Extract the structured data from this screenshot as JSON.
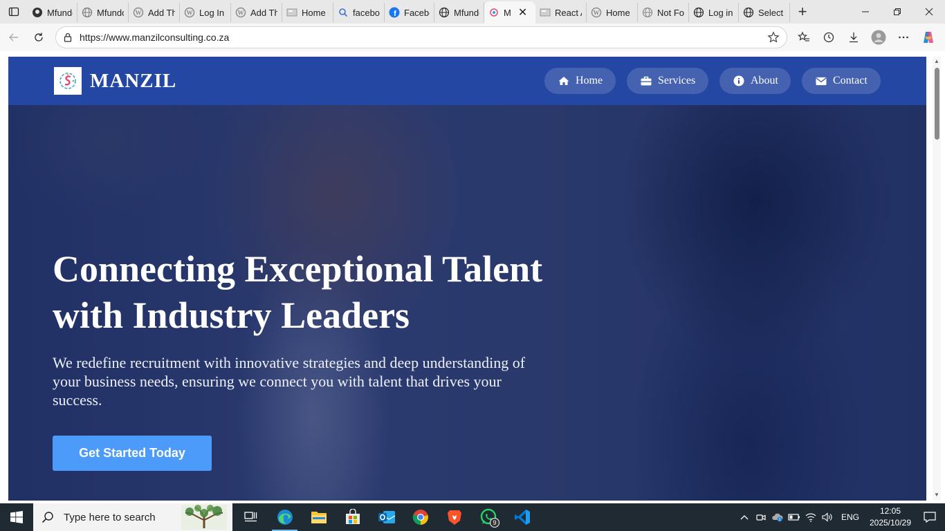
{
  "browser": {
    "tabs": [
      {
        "label": "Mfundo",
        "icon": "github-icon"
      },
      {
        "label": "Mfundo",
        "icon": "globe-icon"
      },
      {
        "label": "Add Th",
        "icon": "wordpress-icon"
      },
      {
        "label": "Log In",
        "icon": "wordpress-icon"
      },
      {
        "label": "Add Th",
        "icon": "wordpress-icon"
      },
      {
        "label": "Home -",
        "icon": "page-icon"
      },
      {
        "label": "facebo",
        "icon": "search-icon"
      },
      {
        "label": "Facebo",
        "icon": "facebook-icon"
      },
      {
        "label": "Mfundo",
        "icon": "globe-icon"
      },
      {
        "label": "M",
        "icon": "manzil-logo-icon",
        "active": true
      },
      {
        "label": "React A",
        "icon": "page-icon"
      },
      {
        "label": "Home",
        "icon": "wordpress-icon"
      },
      {
        "label": "Not Fo",
        "icon": "globe-icon"
      },
      {
        "label": "Log in",
        "icon": "globe-icon"
      },
      {
        "label": "Select c",
        "icon": "globe-icon"
      }
    ],
    "url": "https://www.manzilconsulting.co.za"
  },
  "site": {
    "brand": "MANZIL",
    "nav": [
      {
        "label": "Home",
        "icon": "home-icon"
      },
      {
        "label": "Services",
        "icon": "briefcase-icon"
      },
      {
        "label": "About",
        "icon": "info-icon"
      },
      {
        "label": "Contact",
        "icon": "envelope-icon"
      }
    ],
    "hero": {
      "headline": "Connecting Exceptional Talent with Industry Leaders",
      "subtext": "We redefine recruitment with innovative strategies and deep understanding of your business needs, ensuring we connect you with talent that drives your success.",
      "cta": "Get Started Today"
    }
  },
  "taskbar": {
    "search_placeholder": "Type here to search",
    "apps": [
      "task-view-icon",
      "edge-icon",
      "file-explorer-icon",
      "store-icon",
      "outlook-icon",
      "chrome-icon",
      "brave-icon",
      "whatsapp-icon",
      "vscode-icon"
    ],
    "whatsapp_badge": "9",
    "language": "ENG",
    "time": "12:05",
    "date": "2025/10/29"
  },
  "colors": {
    "navbar": "#2447a3",
    "cta": "#4c9bfa",
    "overlay": "#182864"
  }
}
